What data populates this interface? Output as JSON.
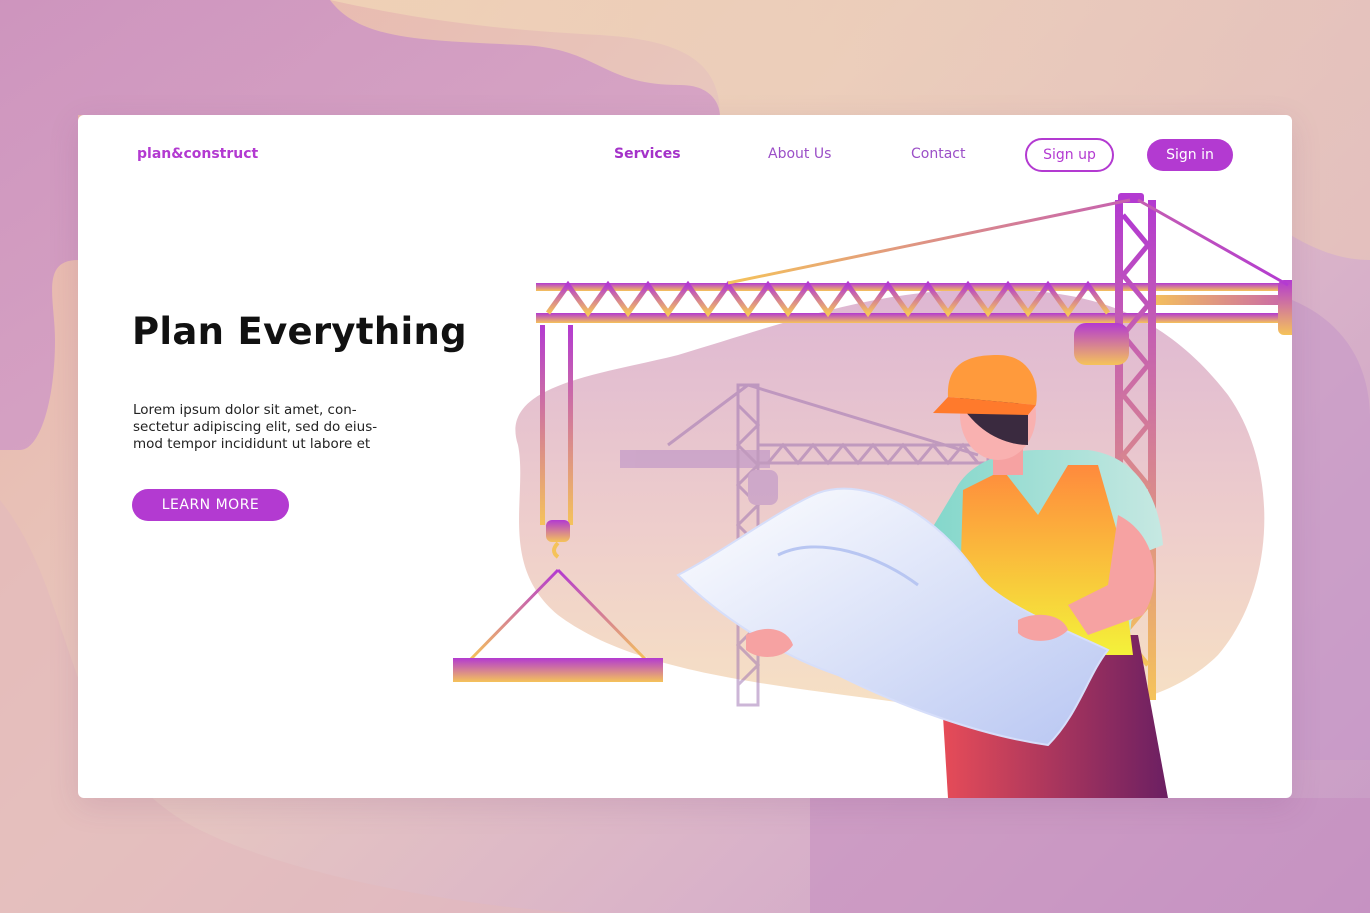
{
  "brand": "plan&construct",
  "nav": {
    "services": "Services",
    "about": "About Us",
    "contact": "Contact"
  },
  "auth": {
    "signup": "Sign up",
    "signin": "Sign in"
  },
  "hero": {
    "title": "Plan Everything",
    "text_lines": [
      "Lorem ipsum dolor sit amet, con-",
      "sectetur adipiscing elit, sed do eius-",
      "mod tempor incididunt ut labore et"
    ],
    "cta": "LEARN MORE"
  },
  "colors": {
    "accent": "#b33ad1",
    "crane_top": "#b33ad1",
    "crane_bottom": "#f5c35a"
  },
  "icons": {
    "illustration": "construction-worker-with-blueprint-and-cranes"
  }
}
